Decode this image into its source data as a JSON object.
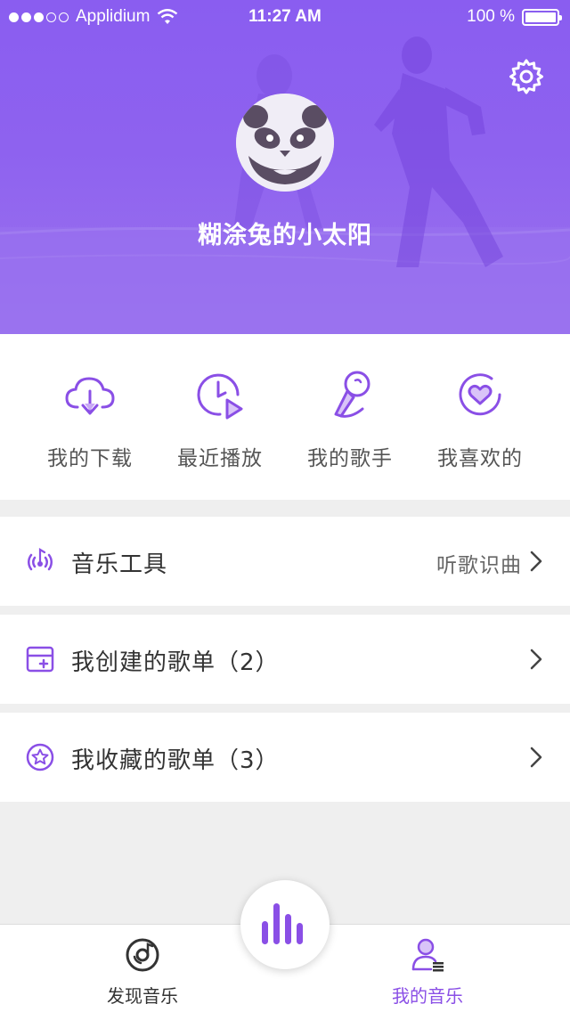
{
  "status_bar": {
    "carrier": "Applidium",
    "time": "11:27 AM",
    "battery": "100 %"
  },
  "profile": {
    "username": "糊涂兔的小太阳"
  },
  "quick_actions": [
    {
      "label": "我的下载",
      "icon": "cloud-download-icon"
    },
    {
      "label": "最近播放",
      "icon": "recent-play-icon"
    },
    {
      "label": "我的歌手",
      "icon": "microphone-icon"
    },
    {
      "label": "我喜欢的",
      "icon": "heart-icon"
    }
  ],
  "rows": {
    "tools": {
      "title": "音乐工具",
      "right_text": "听歌识曲"
    },
    "created": {
      "title": "我创建的歌单（2）"
    },
    "collected": {
      "title": "我收藏的歌单（3）"
    }
  },
  "tabbar": {
    "discover": "发现音乐",
    "mine": "我的音乐"
  },
  "colors": {
    "accent": "#8a4fe6",
    "header": "#8e62ef"
  }
}
